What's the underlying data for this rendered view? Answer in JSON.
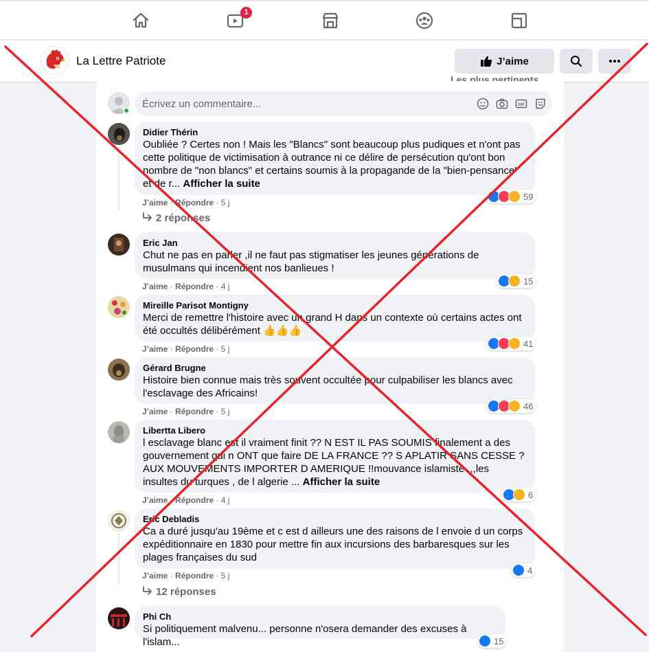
{
  "nav": {
    "icons": [
      "home-icon",
      "watch-icon",
      "marketplace-icon",
      "groups-icon",
      "gaming-icon"
    ],
    "watch_badge": "1"
  },
  "page": {
    "name": "La Lettre Patriote",
    "like_label": "J’aime"
  },
  "sort": {
    "label": "Les plus pertinents"
  },
  "composer": {
    "placeholder": "Écrivez un commentaire..."
  },
  "comments": [
    {
      "author": "Didier Thérin",
      "text": "Oubliée ? Certes non ! Mais les \"Blancs\" sont beaucoup plus pudiques et n'ont pas cette politique de victimisation à outrance ni ce délire de persécution qu'ont bon nombre de \"non blancs\" et certains soumis à la propagande de la \"bien-pensance\" et de r... ",
      "see_more": "Afficher la suite",
      "like": "J’aime",
      "reply": "Répondre",
      "time": "5 j",
      "reactions": "59",
      "replies": "2 réponses"
    },
    {
      "author": "Eric Jan",
      "text": "Chut ne pas en parler ,il ne faut pas stigmatiser les jeunes générations de musulmans qui incendient nos banlieues !",
      "like": "J’aime",
      "reply": "Répondre",
      "time": "4 j",
      "reactions": "15"
    },
    {
      "author": "Mireille Parisot Montigny",
      "text": "Merci de remettre l'histoire avec un grand H dans un contexte où certains actes ont été occultés délibérément 👍👍👍",
      "like": "J’aime",
      "reply": "Répondre",
      "time": "5 j",
      "reactions": "41"
    },
    {
      "author": "Gérard Brugne",
      "text": "Histoire bien connue mais très souvent occultée pour culpabiliser les blancs avec l'esclavage des Africains!",
      "like": "J’aime",
      "reply": "Répondre",
      "time": "5 j",
      "reactions": "46"
    },
    {
      "author": "Libertta Libero",
      "text": "l esclavage blanc est il vraiment finit ?? N EST IL PAS SOUMIS finalement a des gouvernement qui n ONT que faire DE LA FRANCE ?? S APLATIR SANS CESSE ? AUX MOUVEMENTS IMPORTER D AMERIQUE !!mouvance islamiste ,,,les insultes du turques , de l algerie ... ",
      "see_more": "Afficher la suite",
      "like": "J’aime",
      "reply": "Répondre",
      "time": "4 j",
      "reactions": "6"
    },
    {
      "author": "Eric Debladis",
      "text": "Ca a duré jusqu'au 19ème et c est d ailleurs une des raisons de l envoie d un corps expéditionnaire en 1830 pour mettre fin aux incursions des barbaresques sur les plages françaises du sud",
      "like": "J’aime",
      "reply": "Répondre",
      "time": "5 j",
      "reactions": "4",
      "replies": "12 réponses"
    },
    {
      "author": "Phi Ch",
      "text": "Si politiquement malvenu... personne n'osera demander des excuses à l'islam...",
      "reactions": "15"
    }
  ],
  "colors": {
    "accent": "#1877f2",
    "cross": "#e3262b",
    "love": "#f33e58",
    "care": "#f7b125"
  }
}
